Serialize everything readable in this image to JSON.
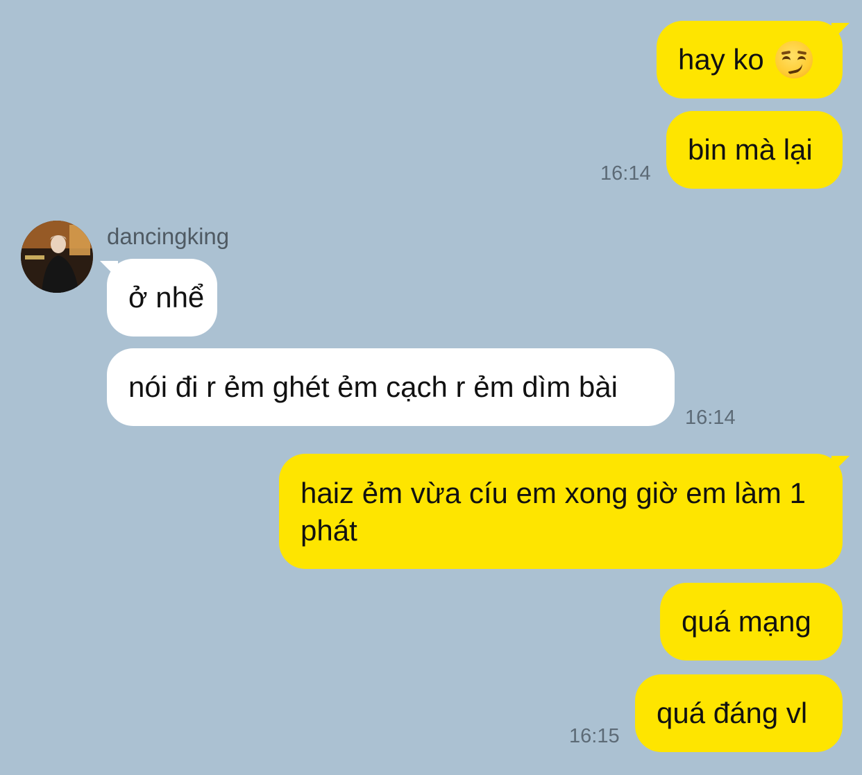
{
  "chat": {
    "messages": [
      {
        "text": "hay ko",
        "emoji": "smirking-face-icon"
      },
      {
        "text": "bin mà lại"
      },
      {
        "text": "ở nhể"
      },
      {
        "text": "nói đi r ẻm ghét ẻm cạch r ẻm dìm bài"
      },
      {
        "text": "haiz ẻm vừa cíu em xong giờ em làm 1 phát"
      },
      {
        "text": "quá mạng"
      },
      {
        "text": "quá đáng vl"
      }
    ],
    "timestamps": [
      "16:14",
      "16:14",
      "16:15"
    ]
  },
  "contact": {
    "name": "dancingking"
  },
  "colors": {
    "background": "#abc1d2",
    "my_bubble": "#fee500",
    "their_bubble": "#ffffff"
  }
}
